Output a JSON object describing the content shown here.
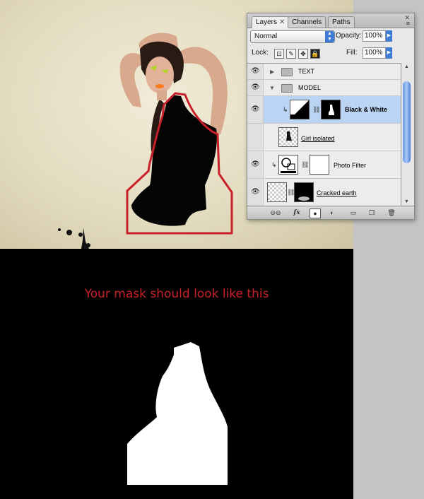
{
  "caption": "Your mask should look like this",
  "panel": {
    "tabs": [
      {
        "label": "Layers",
        "active": true,
        "closable": true
      },
      {
        "label": "Channels",
        "active": false
      },
      {
        "label": "Paths",
        "active": false
      }
    ],
    "blend_mode": "Normal",
    "opacity_label": "Opacity:",
    "opacity_value": "100%",
    "lock_label": "Lock:",
    "fill_label": "Fill:",
    "fill_value": "100%",
    "layers": [
      {
        "name": "TEXT",
        "type": "group",
        "expanded": false,
        "visible": true
      },
      {
        "name": "MODEL",
        "type": "group",
        "expanded": true,
        "visible": true
      },
      {
        "name": "Black & White",
        "type": "adjustment",
        "selected": true,
        "clipped": true,
        "visible": true
      },
      {
        "name": "Girl isolated",
        "type": "pixel",
        "visible": false
      },
      {
        "name": "Photo Filter",
        "type": "adjustment",
        "clipped": true,
        "visible": true
      },
      {
        "name": "Cracked earth",
        "type": "pixel",
        "visible": true
      }
    ],
    "footer_icons": [
      "link-icon",
      "fx-icon",
      "mask-icon",
      "adjustment-icon",
      "folder-icon",
      "new-layer-icon",
      "trash-icon"
    ],
    "footer_fx_label": "fx"
  },
  "colors": {
    "selection_outline": "#c8202a",
    "caption": "#c8202a",
    "selected_row": "#bcd4f4"
  }
}
